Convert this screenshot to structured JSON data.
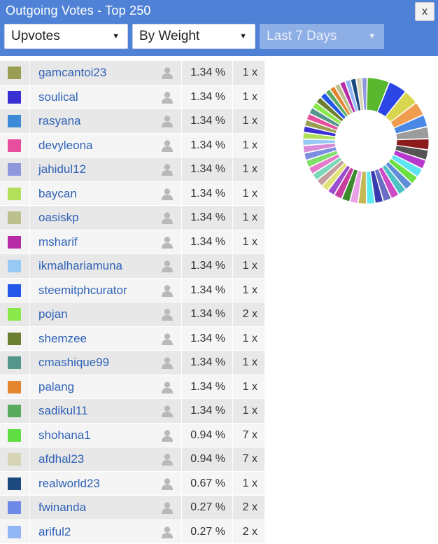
{
  "window": {
    "title": "Outgoing Votes - Top 250",
    "close_label": "x"
  },
  "filters": {
    "vote_type": "Upvotes",
    "sort_by": "By Weight",
    "period": "Last 7 Days"
  },
  "rows": [
    {
      "color": "#9a9e52",
      "name": "gamcantoi23",
      "pct": "1.34 %",
      "count": "1 x"
    },
    {
      "color": "#3a2fd0",
      "name": "soulical",
      "pct": "1.34 %",
      "count": "1 x"
    },
    {
      "color": "#3d8ad6",
      "name": "rasyana",
      "pct": "1.34 %",
      "count": "1 x"
    },
    {
      "color": "#e64e9e",
      "name": "devyleona",
      "pct": "1.34 %",
      "count": "1 x"
    },
    {
      "color": "#8e97dc",
      "name": "jahidul12",
      "pct": "1.34 %",
      "count": "1 x"
    },
    {
      "color": "#b3e05a",
      "name": "baycan",
      "pct": "1.34 %",
      "count": "1 x"
    },
    {
      "color": "#bcc08f",
      "name": "oasiskp",
      "pct": "1.34 %",
      "count": "1 x"
    },
    {
      "color": "#b62ba6",
      "name": "msharif",
      "pct": "1.34 %",
      "count": "1 x"
    },
    {
      "color": "#98c9f4",
      "name": "ikmalhariamuna",
      "pct": "1.34 %",
      "count": "1 x"
    },
    {
      "color": "#2456ea",
      "name": "steemitphcurator",
      "pct": "1.34 %",
      "count": "1 x"
    },
    {
      "color": "#8be84a",
      "name": "pojan",
      "pct": "1.34 %",
      "count": "2 x"
    },
    {
      "color": "#6c7f33",
      "name": "shemzee",
      "pct": "1.34 %",
      "count": "1 x"
    },
    {
      "color": "#55968b",
      "name": "cmashique99",
      "pct": "1.34 %",
      "count": "1 x"
    },
    {
      "color": "#e3862f",
      "name": "palang",
      "pct": "1.34 %",
      "count": "1 x"
    },
    {
      "color": "#5aab5f",
      "name": "sadikul11",
      "pct": "1.34 %",
      "count": "1 x"
    },
    {
      "color": "#5fdd43",
      "name": "shohana1",
      "pct": "0.94 %",
      "count": "7 x"
    },
    {
      "color": "#d6d3b6",
      "name": "afdhal23",
      "pct": "0.94 %",
      "count": "7 x"
    },
    {
      "color": "#1d4a7e",
      "name": "realworld23",
      "pct": "0.67 %",
      "count": "1 x"
    },
    {
      "color": "#6e8ae6",
      "name": "fwinanda",
      "pct": "0.27 %",
      "count": "2 x"
    },
    {
      "color": "#93b7f4",
      "name": "ariful2",
      "pct": "0.27 %",
      "count": "2 x"
    }
  ],
  "chart_data": {
    "type": "pie",
    "donut": true,
    "colors": [
      "#5ab82e",
      "#2b45e6",
      "#d8d64e",
      "#ef9c4e",
      "#4a88e6",
      "#9c9c9c",
      "#8c1c1c",
      "#555555",
      "#b838ce",
      "#5ce4f2",
      "#6be043",
      "#5f8dd6",
      "#4dc1c6",
      "#cd4cc6",
      "#6a6ec4",
      "#3a3ab0",
      "#5aeaf0",
      "#c4b852",
      "#e8a0e6",
      "#3b8a2d",
      "#c93fa0",
      "#9a4dcf",
      "#e2e276",
      "#c49e9e",
      "#7cd7b8",
      "#e47ac9",
      "#7fdf69",
      "#7d8fe0",
      "#d98bd8",
      "#98c9f4",
      "#b0e05a",
      "#3a2fd0",
      "#9a9e52",
      "#e64e9e",
      "#55968b",
      "#8be84a",
      "#6c7f33",
      "#2456ea",
      "#5aab5f",
      "#e3862f",
      "#bcc08f",
      "#b62ba6",
      "#93b7f4",
      "#1d4a7e",
      "#d6d3b6",
      "#8e97dc"
    ],
    "values": [
      12,
      10,
      8,
      7.5,
      6.5,
      6.5,
      6,
      5.5,
      5,
      5,
      4.5,
      4.5,
      4.5,
      4.5,
      4.5,
      4.5,
      4.5,
      4.5,
      4.5,
      4.5,
      4.5,
      4,
      4,
      4,
      4,
      4,
      4,
      4,
      4,
      3.5,
      3.5,
      3.5,
      3.5,
      3.5,
      3.5,
      3.5,
      3.5,
      3.5,
      3,
      3,
      3,
      3,
      3,
      3,
      3,
      3
    ]
  }
}
